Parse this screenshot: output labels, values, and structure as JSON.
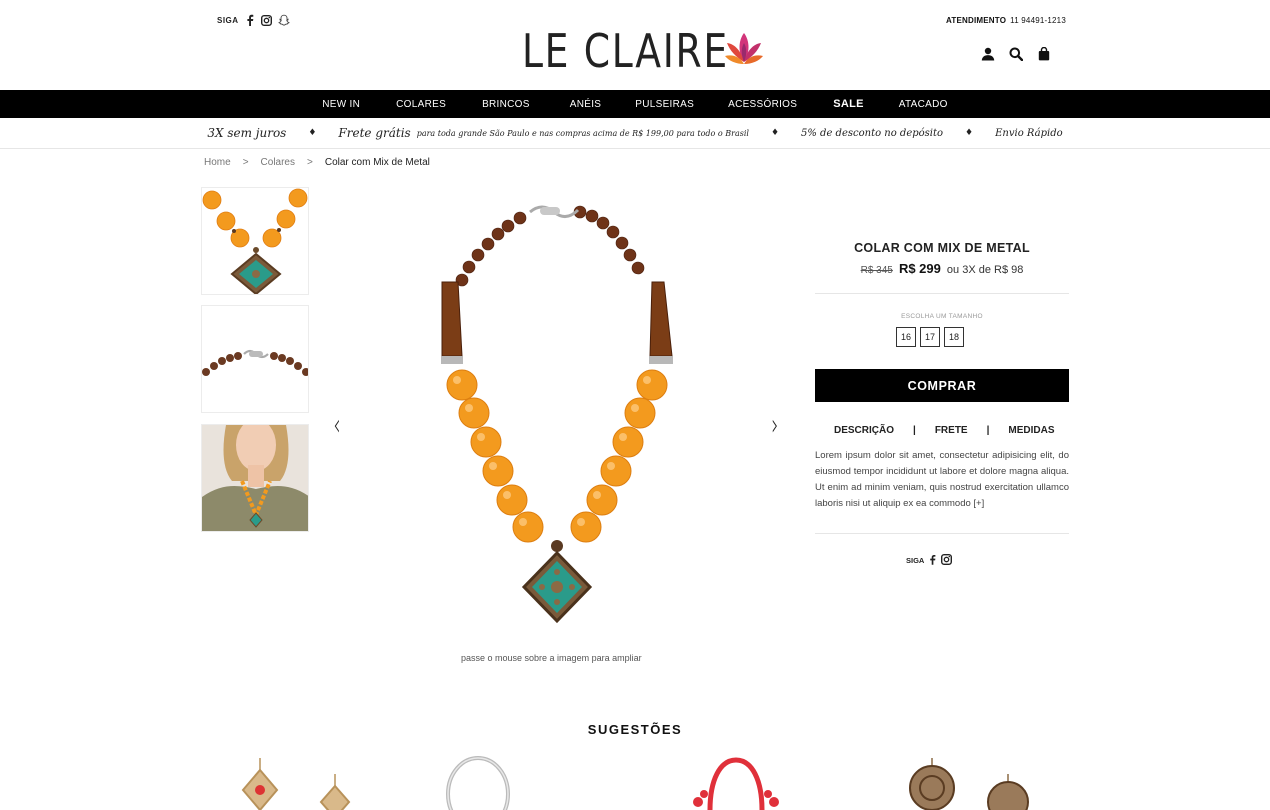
{
  "header": {
    "follow_label": "SIGA",
    "logo_text": "LE CLAIRE",
    "contact_label": "ATENDIMENTO",
    "contact_phone": "11 94491-1213",
    "icons": [
      "user-icon",
      "search-icon",
      "bag-icon"
    ],
    "social_icons": [
      "facebook-icon",
      "instagram-icon",
      "snapchat-icon"
    ]
  },
  "nav": {
    "items": [
      {
        "label": "NEW IN"
      },
      {
        "label": "COLARES"
      },
      {
        "label": "BRINCOS"
      },
      {
        "label": "ANÉIS"
      },
      {
        "label": "PULSEIRAS"
      },
      {
        "label": "ACESSÓRIOS"
      },
      {
        "label": "SALE"
      },
      {
        "label": "ATACADO"
      }
    ]
  },
  "promo": {
    "installments": "3X sem juros",
    "shipping_title": "Frete grátis",
    "shipping_detail": "para toda grande São Paulo e nas compras acima de R$ 199,00 para todo o Brasil",
    "discount": "5% de desconto no depósito",
    "fast": "Envio Rápido"
  },
  "breadcrumb": {
    "home": "Home",
    "sep": ">",
    "category": "Colares",
    "current": "Colar com Mix de Metal"
  },
  "gallery": {
    "hint": "passe o mouse sobre a imagem para ampliar",
    "prev": "‹",
    "next": "›"
  },
  "product": {
    "name": "COLAR COM MIX DE METAL",
    "old_price": "R$ 345",
    "price": "R$ 299",
    "installments": "ou 3X de R$ 98",
    "size_label": "ESCOLHA UM TAMANHO",
    "sizes": [
      "16",
      "17",
      "18"
    ],
    "buy_label": "COMPRAR",
    "tabs": [
      "DESCRIÇÃO",
      "FRETE",
      "MEDIDAS"
    ],
    "tab_sep": "|",
    "description": "Lorem ipsum dolor sit amet, consectetur adipisicing elit, do eiusmod tempor incididunt ut labore et dolore magna aliqua. Ut enim ad minim veniam, quis nostrud exercitation ullamco laboris nisi ut aliquip ex ea commodo [+]",
    "follow_label": "SIGA"
  },
  "suggestions": {
    "title": "SUGESTÕES"
  },
  "colors": {
    "amber": "#f39a1e",
    "turquoise": "#2a9b8a",
    "nav_bg": "#000000"
  }
}
